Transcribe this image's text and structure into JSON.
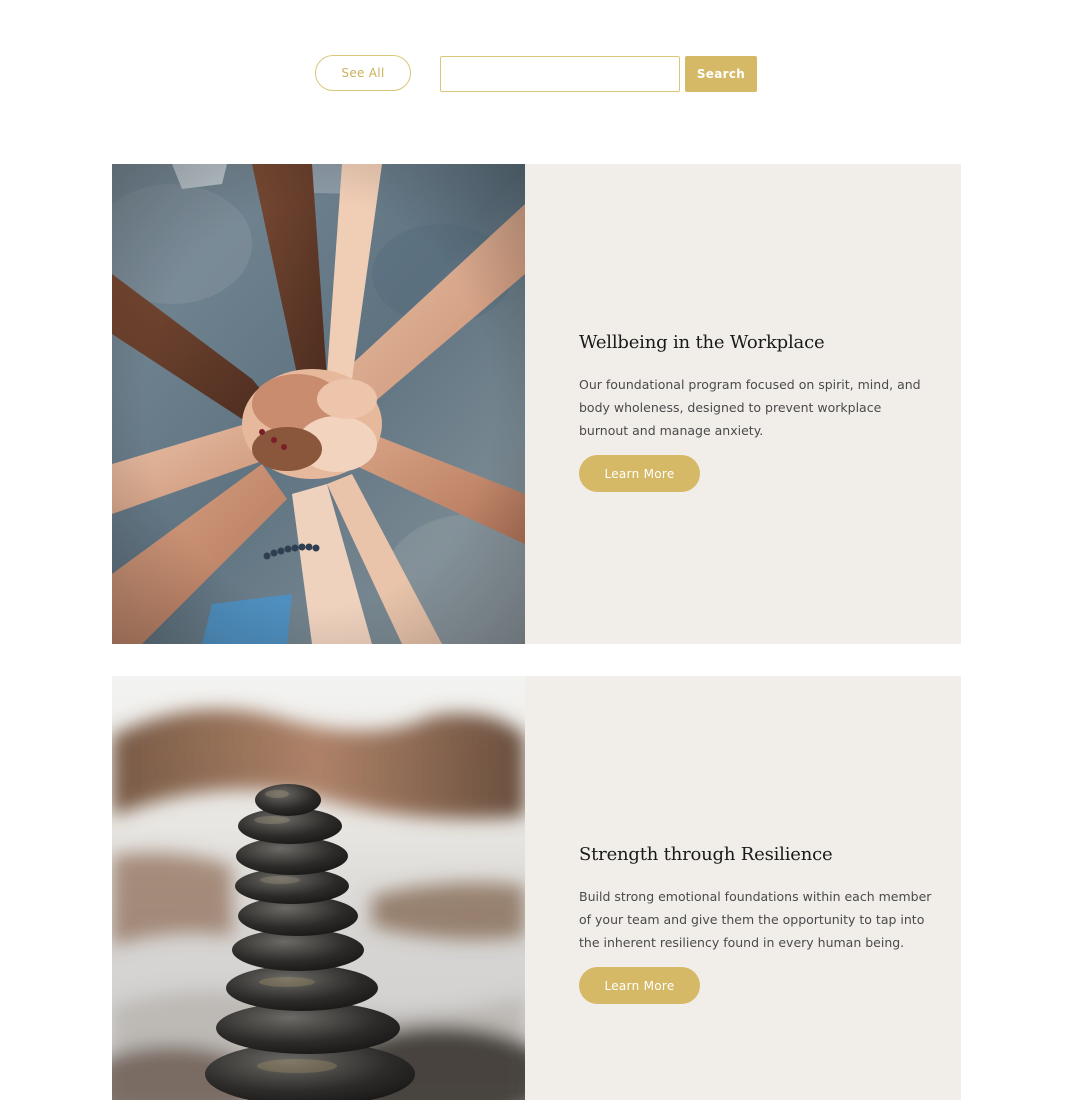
{
  "filter_bar": {
    "see_all_label": "See All",
    "search_placeholder": "",
    "search_value": "",
    "search_button_label": "Search"
  },
  "programs": [
    {
      "title": "Wellbeing in the Workplace",
      "description": "Our foundational program focused on spirit, mind, and body wholeness, designed to prevent workplace burnout and manage anxiety.",
      "button_label": "Learn More",
      "image": "photo-stacked-hands"
    },
    {
      "title": "Strength through Resilience",
      "description": "Build strong emotional foundations within each member of your team and give them the opportunity to tap into the inherent resiliency found in every human being.",
      "button_label": "Learn More",
      "image": "photo-stacked-stones"
    }
  ],
  "colors": {
    "accent_gold": "#d5b966",
    "panel_background": "#f1eeea",
    "outline_gold": "#d9c77a"
  }
}
